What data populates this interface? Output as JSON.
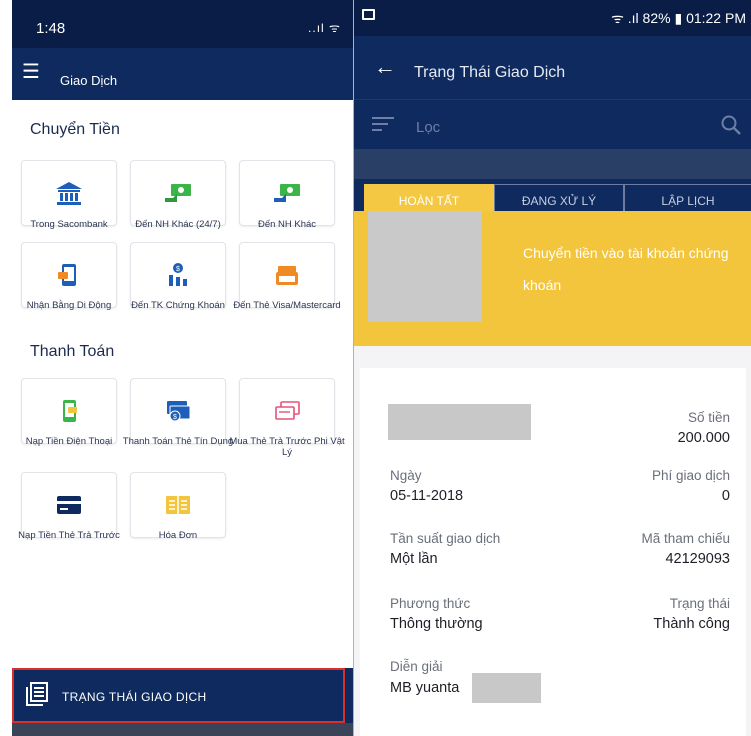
{
  "left": {
    "status": {
      "time": "1:48",
      "icons": "..ıl ᯤ"
    },
    "appbar": {
      "menu_icon": "menu-icon",
      "title": "Giao Dịch"
    },
    "transfer": {
      "title": "Chuyển Tiền",
      "items": [
        {
          "label": "Trong Sacombank",
          "icon": "bank-icon"
        },
        {
          "label": "Đến NH Khác (24/7)",
          "icon": "money-transfer-fast-icon"
        },
        {
          "label": "Đến NH Khác",
          "icon": "money-transfer-icon"
        },
        {
          "label": "Nhận Bằng Di Động",
          "icon": "mobile-phone-icon"
        },
        {
          "label": "Đến TK Chứng Khoán",
          "icon": "stocks-icon"
        },
        {
          "label": "Đến Thẻ Visa/Mastercard",
          "icon": "wallet-card-icon"
        }
      ]
    },
    "payment": {
      "title": "Thanh Toán",
      "items": [
        {
          "label": "Nạp Tiền Điện Thoại",
          "icon": "phone-topup-icon"
        },
        {
          "label": "Thanh Toán Thẻ Tín Dụng",
          "icon": "credit-card-payment-icon"
        },
        {
          "label": "Mua Thẻ Trả Trước Phi Vật Lý",
          "icon": "prepaid-card-icon"
        },
        {
          "label": "Nạp Tiền Thẻ Trả Trước",
          "icon": "card-icon"
        },
        {
          "label": "Hóa Đơn",
          "icon": "bill-icon"
        }
      ]
    },
    "footer": {
      "label": "TRẠNG THÁI GIAO DỊCH"
    }
  },
  "right": {
    "status": {
      "icons": "ᯤ .ıl 82% ▮ 01:22 PM"
    },
    "appbar": {
      "title": "Trạng Thái Giao Dịch"
    },
    "filter": {
      "placeholder": "Lọc"
    },
    "tabs": [
      "HOÀN TẤT",
      "ĐANG XỬ LÝ",
      "LẬP LỊCH"
    ],
    "banner": {
      "text": "Chuyển tiền vào tài khoản chứng khoán"
    },
    "details": {
      "amount": {
        "label": "Số tiền",
        "value": "200.000"
      },
      "date": {
        "label": "Ngày",
        "value": "05-11-2018"
      },
      "fee": {
        "label": "Phí giao dịch",
        "value": "0"
      },
      "frequency": {
        "label": "Tần suất giao dịch",
        "value": "Một lần"
      },
      "reference": {
        "label": "Mã tham chiếu",
        "value": "42129093"
      },
      "method": {
        "label": "Phương thức",
        "value": "Thông thường"
      },
      "status": {
        "label": "Trạng thái",
        "value": "Thành công"
      },
      "description": {
        "label": "Diễn giải",
        "value": "MB yuanta"
      }
    }
  },
  "colors": {
    "navy": "#0e2a5e",
    "accent_yellow": "#f2c53d",
    "icon_blue": "#1d5fb8",
    "icon_green": "#3bb54a",
    "icon_orange": "#f08a24",
    "highlight_red": "#d9302c"
  }
}
